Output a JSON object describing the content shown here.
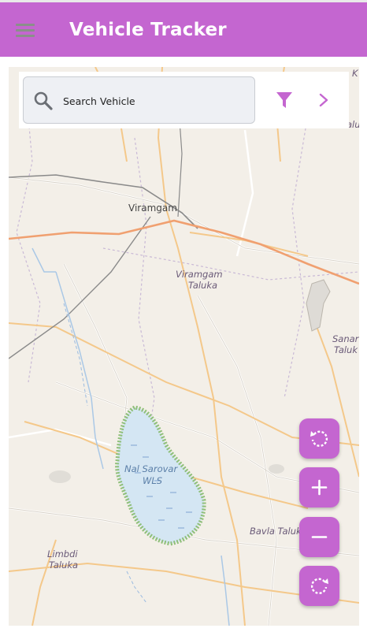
{
  "app": {
    "title": "Vehicle Tracker",
    "menu_icon": "hamburger-menu-icon",
    "accent_color": "#c466d0"
  },
  "search": {
    "label": "Search Vehicle",
    "icon": "search-icon",
    "filter_icon": "filter-icon",
    "next_icon": "chevron-right-icon"
  },
  "map": {
    "labels": {
      "viramgam": "Viramgam",
      "viramgam_taluka_1": "Viramgam",
      "viramgam_taluka_2": "Taluka",
      "sanand_1": "Sanar",
      "sanand_2": "Taluk",
      "nal_sarovar_1": "Nal Sarovar",
      "nal_sarovar_2": "WLS",
      "bavla": "Bavla Taluk",
      "limbdi_1": "Limbdi",
      "limbdi_2": "Taluka",
      "edge_k": "K",
      "edge_talu": "alu"
    }
  },
  "controls": {
    "rotate_left_icon": "rotate-left-icon",
    "zoom_in_icon": "zoom-in-icon",
    "zoom_out_icon": "zoom-out-icon",
    "rotate_right_icon": "rotate-right-icon"
  }
}
